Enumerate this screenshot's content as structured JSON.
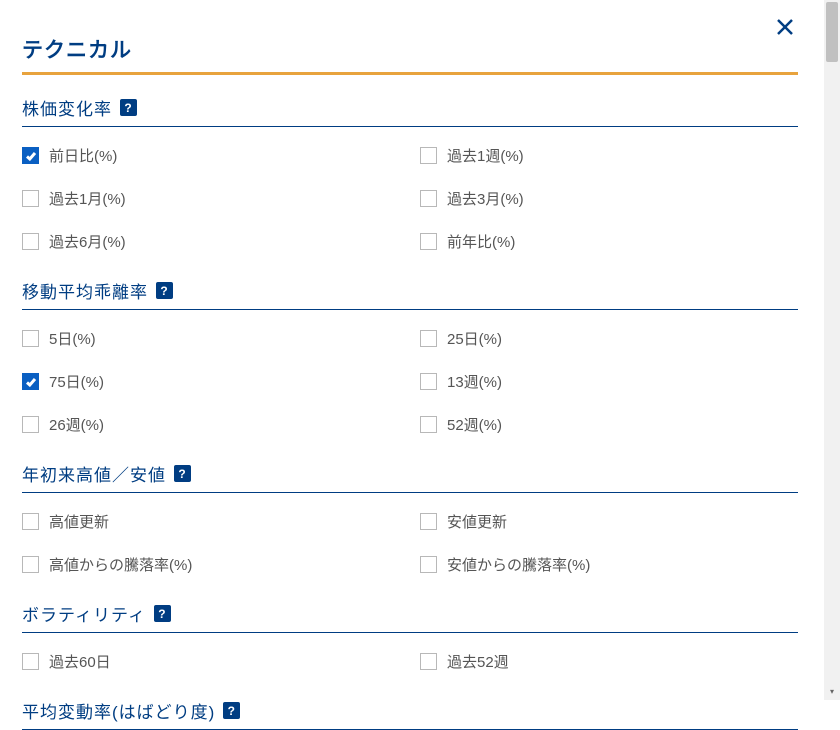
{
  "page_title": "テクニカル",
  "sections": [
    {
      "title": "株価変化率",
      "options": [
        {
          "label": "前日比(%)",
          "checked": true
        },
        {
          "label": "過去1週(%)",
          "checked": false
        },
        {
          "label": "過去1月(%)",
          "checked": false
        },
        {
          "label": "過去3月(%)",
          "checked": false
        },
        {
          "label": "過去6月(%)",
          "checked": false
        },
        {
          "label": "前年比(%)",
          "checked": false
        }
      ]
    },
    {
      "title": "移動平均乖離率",
      "options": [
        {
          "label": "5日(%)",
          "checked": false
        },
        {
          "label": "25日(%)",
          "checked": false
        },
        {
          "label": "75日(%)",
          "checked": true
        },
        {
          "label": "13週(%)",
          "checked": false
        },
        {
          "label": "26週(%)",
          "checked": false
        },
        {
          "label": "52週(%)",
          "checked": false
        }
      ]
    },
    {
      "title": "年初来高値／安値",
      "options": [
        {
          "label": "高値更新",
          "checked": false
        },
        {
          "label": "安値更新",
          "checked": false
        },
        {
          "label": "高値からの騰落率(%)",
          "checked": false
        },
        {
          "label": "安値からの騰落率(%)",
          "checked": false
        }
      ]
    },
    {
      "title": "ボラティリティ",
      "options": [
        {
          "label": "過去60日",
          "checked": false
        },
        {
          "label": "過去52週",
          "checked": false
        }
      ]
    },
    {
      "title": "平均変動率(はばどり度)",
      "options": []
    }
  ]
}
